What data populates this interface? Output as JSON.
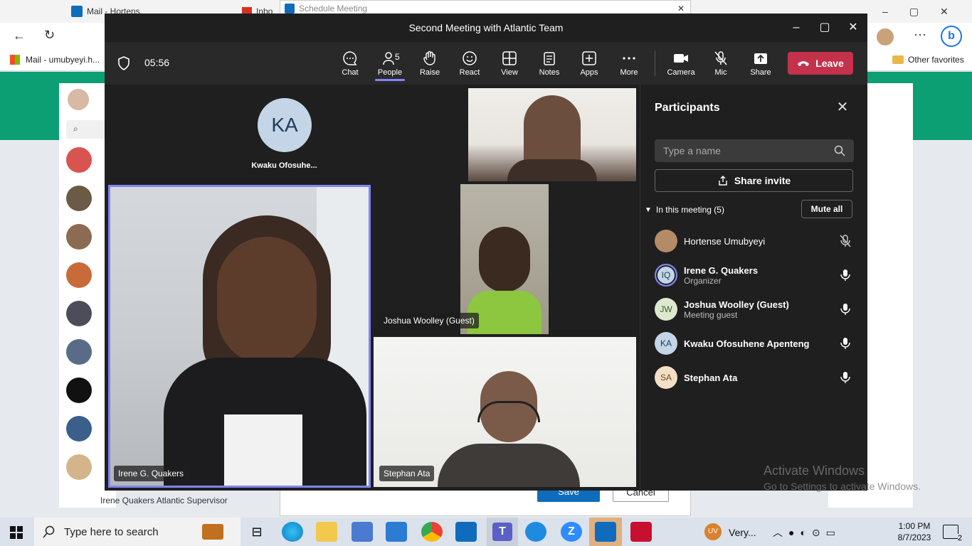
{
  "browser": {
    "tabs": [
      "Mail - Hortens",
      "Inbo"
    ],
    "fav_mail": "Mail - umubyeyi.h...",
    "fav_other": "Other favorites"
  },
  "outlook": {
    "last_contact": "Irene Quakers Atlantic Supervisor"
  },
  "schedule": {
    "title": "Schedule Meeting",
    "save": "Save",
    "cancel": "Cancel"
  },
  "teams": {
    "title": "Second Meeting with Atlantic Team",
    "timer": "05:56",
    "toolbar": [
      {
        "name": "chat",
        "label": "Chat"
      },
      {
        "name": "people",
        "label": "People",
        "count": "5"
      },
      {
        "name": "raise",
        "label": "Raise"
      },
      {
        "name": "react",
        "label": "React"
      },
      {
        "name": "view",
        "label": "View"
      },
      {
        "name": "notes",
        "label": "Notes"
      },
      {
        "name": "apps",
        "label": "Apps"
      },
      {
        "name": "more",
        "label": "More"
      },
      {
        "name": "camera",
        "label": "Camera"
      },
      {
        "name": "mic",
        "label": "Mic"
      },
      {
        "name": "share",
        "label": "Share"
      }
    ],
    "leave": "Leave",
    "tiles": {
      "ka_initials": "KA",
      "ka_name": "Kwaku Ofosuhe...",
      "irene": "Irene G. Quakers",
      "joshua": "Joshua Woolley (Guest)",
      "stephan": "Stephan Ata"
    },
    "panel": {
      "title": "Participants",
      "search_placeholder": "Type a name",
      "share_invite": "Share invite",
      "in_meeting": "In this meeting (5)",
      "mute_all": "Mute all",
      "participants": [
        {
          "initials": "",
          "name": "Hortense Umubyeyi",
          "sub": "",
          "mic": "muted"
        },
        {
          "initials": "IQ",
          "name": "Irene G. Quakers",
          "sub": "Organizer",
          "mic": "on"
        },
        {
          "initials": "JW",
          "name": "Joshua Woolley (Guest)",
          "sub": "Meeting guest",
          "mic": "on"
        },
        {
          "initials": "KA",
          "name": "Kwaku Ofosuhene Apenteng",
          "sub": "",
          "mic": "on"
        },
        {
          "initials": "SA",
          "name": "Stephan Ata",
          "sub": "",
          "mic": "on"
        }
      ]
    }
  },
  "watermark": {
    "line1": "Activate Windows",
    "line2": "Go to Settings to activate Windows."
  },
  "taskbar": {
    "search_placeholder": "Type here to search",
    "weather": "Very...",
    "time": "1:00 PM",
    "date": "8/7/2023",
    "notif_count": "2",
    "user_badge": "UV"
  },
  "colors": {
    "leave": "#c4314b",
    "accent": "#7f85f5",
    "green_band": "#0d9f74"
  }
}
